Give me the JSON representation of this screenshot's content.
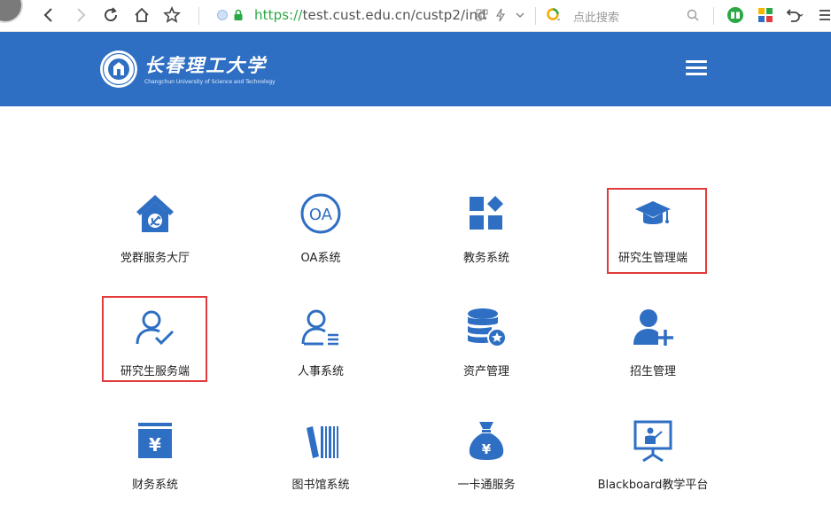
{
  "browser": {
    "url_scheme": "https://",
    "url_rest": "test.cust.edu.cn/custp2/ind",
    "search_placeholder": "点此搜索",
    "icons": [
      "back-icon",
      "forward-icon",
      "reload-icon",
      "home-icon",
      "star-icon",
      "shield-icon",
      "lock-icon",
      "qr-icon",
      "bolt-icon",
      "chevron-down-icon",
      "search-engine-icon",
      "search-icon",
      "reader-icon",
      "apps-icon",
      "undo-icon",
      "menu-icon"
    ],
    "accent": "#2aa845"
  },
  "header": {
    "bg": "#2f6fc3",
    "logo_name": "长春理工大学",
    "logo_en": "Changchun University of Science and Technology"
  },
  "tiles": [
    {
      "label": "党群服务大厅",
      "icon": "party-home-icon"
    },
    {
      "label": "OA系统",
      "icon": "oa-icon"
    },
    {
      "label": "教务系统",
      "icon": "apps-grid-icon"
    },
    {
      "label": "研究生管理端",
      "icon": "graduation-cap-icon"
    },
    {
      "label": "研究生服务端",
      "icon": "user-check-icon"
    },
    {
      "label": "人事系统",
      "icon": "user-list-icon"
    },
    {
      "label": "资产管理",
      "icon": "database-icon"
    },
    {
      "label": "招生管理",
      "icon": "user-plus-icon"
    },
    {
      "label": "财务系统",
      "icon": "finance-box-icon"
    },
    {
      "label": "图书馆系统",
      "icon": "books-icon"
    },
    {
      "label": "一卡通服务",
      "icon": "money-bag-icon"
    },
    {
      "label": "Blackboard教学平台",
      "icon": "presentation-board-icon"
    }
  ],
  "highlight_color": "#e23b3b",
  "icon_color": "#2f6fc3"
}
